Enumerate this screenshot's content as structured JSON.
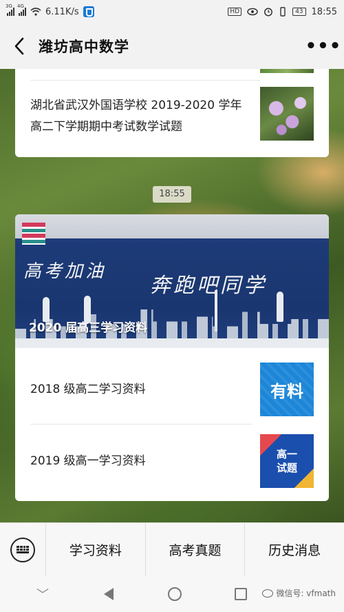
{
  "status_bar": {
    "network_speed": "6.11K/s",
    "signal1": "3G",
    "signal2": "4G",
    "battery": "43",
    "time": "18:55"
  },
  "header": {
    "back_icon": "chevron-left-icon",
    "title": "潍坊高中数学",
    "more_icon": "more-dots-icon"
  },
  "messages": {
    "card1": {
      "article_title": "湖北省武汉外国语学校 2019-2020 学年高二下学期期中考试数学试题"
    },
    "timestamp": "18:55",
    "card2": {
      "banner": {
        "chalk_left": "高考加油",
        "chalk_right": "奔跑吧同学",
        "caption": "2020 届高三学习资料"
      },
      "items": [
        {
          "label": "2018 级高二学习资料",
          "thumb_text": "有料"
        },
        {
          "label": "2019 级高一学习资料",
          "thumb_line1": "高一",
          "thumb_line2": "试题"
        }
      ]
    }
  },
  "bottom_menu": {
    "keyboard_icon": "keyboard-icon",
    "items": [
      "学习资料",
      "高考真题",
      "历史消息"
    ]
  },
  "nav_bar": {
    "watermark": "微信号: vfmath"
  },
  "colors": {
    "bar_bg": "#f2f2f2",
    "card_bg": "#ffffff",
    "accent_blue": "#1c86d8"
  }
}
